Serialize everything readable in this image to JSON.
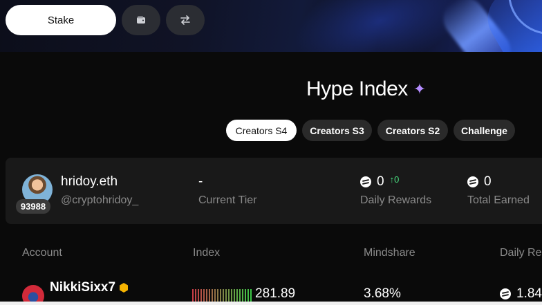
{
  "header": {
    "stake_label": "Stake",
    "wallet_icon": "wallet-icon",
    "swap_icon": "swap-arrows-icon"
  },
  "page": {
    "title": "Hype Index",
    "title_icon": "sparkle-icon"
  },
  "tabs": [
    {
      "label": "Creators S4",
      "active": true
    },
    {
      "label": "Creators S3",
      "active": false
    },
    {
      "label": "Creators S2",
      "active": false
    },
    {
      "label": "Challenge",
      "active": false
    }
  ],
  "profile": {
    "rank": "93988",
    "name": "hridoy.eth",
    "handle": "@cryptohridoy_",
    "tier_value": "-",
    "tier_label": "Current Tier",
    "daily_rewards_value": "0",
    "daily_rewards_delta": "↑0",
    "daily_rewards_label": "Daily Rewards",
    "total_earned_value": "0",
    "total_earned_label": "Total Earned"
  },
  "table": {
    "headers": [
      "Account",
      "Index",
      "Mindshare",
      "Daily Re"
    ],
    "rows": [
      {
        "account": "NikkiSixx7",
        "index": "281.89",
        "mindshare": "3.68%",
        "daily": "1.84"
      }
    ]
  },
  "colors": {
    "accent_green": "#4ade80",
    "verified_badge": "#f5b301",
    "sparkle": "#b48cff"
  }
}
